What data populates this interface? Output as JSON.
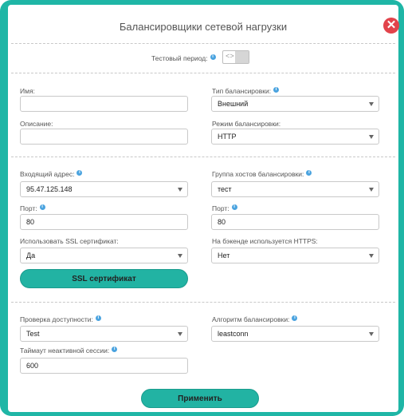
{
  "dialog": {
    "title": "Балансировщики сетевой нагрузки",
    "close_label": "✕",
    "test_period_label": "Тестовый период:",
    "toggle_code": "<>"
  },
  "section1": {
    "name_label": "Имя:",
    "name_value": "",
    "description_label": "Описание:",
    "description_value": "",
    "balancing_type_label": "Тип балансировки:",
    "balancing_type_value": "Внешний",
    "balancing_mode_label": "Режим балансировки:",
    "balancing_mode_value": "HTTP"
  },
  "section2": {
    "incoming_address_label": "Входящий адрес:",
    "incoming_address_value": "95.47.125.148",
    "host_group_label": "Группа хостов балансировки:",
    "host_group_value": "тест",
    "port_label": "Порт:",
    "port_value": "80",
    "backend_port_label": "Порт:",
    "backend_port_value": "80",
    "use_ssl_label": "Использовать SSL сертификат:",
    "use_ssl_value": "Да",
    "backend_https_label": "На бэкенде используется HTTPS:",
    "backend_https_value": "Нет",
    "ssl_button_label": "SSL сертификат"
  },
  "section3": {
    "health_check_label": "Проверка доступности:",
    "health_check_value": "Test",
    "algorithm_label": "Алгоритм балансировки:",
    "algorithm_value": "leastconn",
    "timeout_label": "Таймаут неактивной сессии:",
    "timeout_value": "600"
  },
  "footer": {
    "apply_label": "Применить"
  },
  "colors": {
    "accent": "#22b3a3",
    "close": "#e2434b",
    "info": "#4aa3df"
  },
  "icons": {
    "info": "info-icon",
    "close": "close-icon",
    "dropdown": "chevron-down-icon"
  }
}
